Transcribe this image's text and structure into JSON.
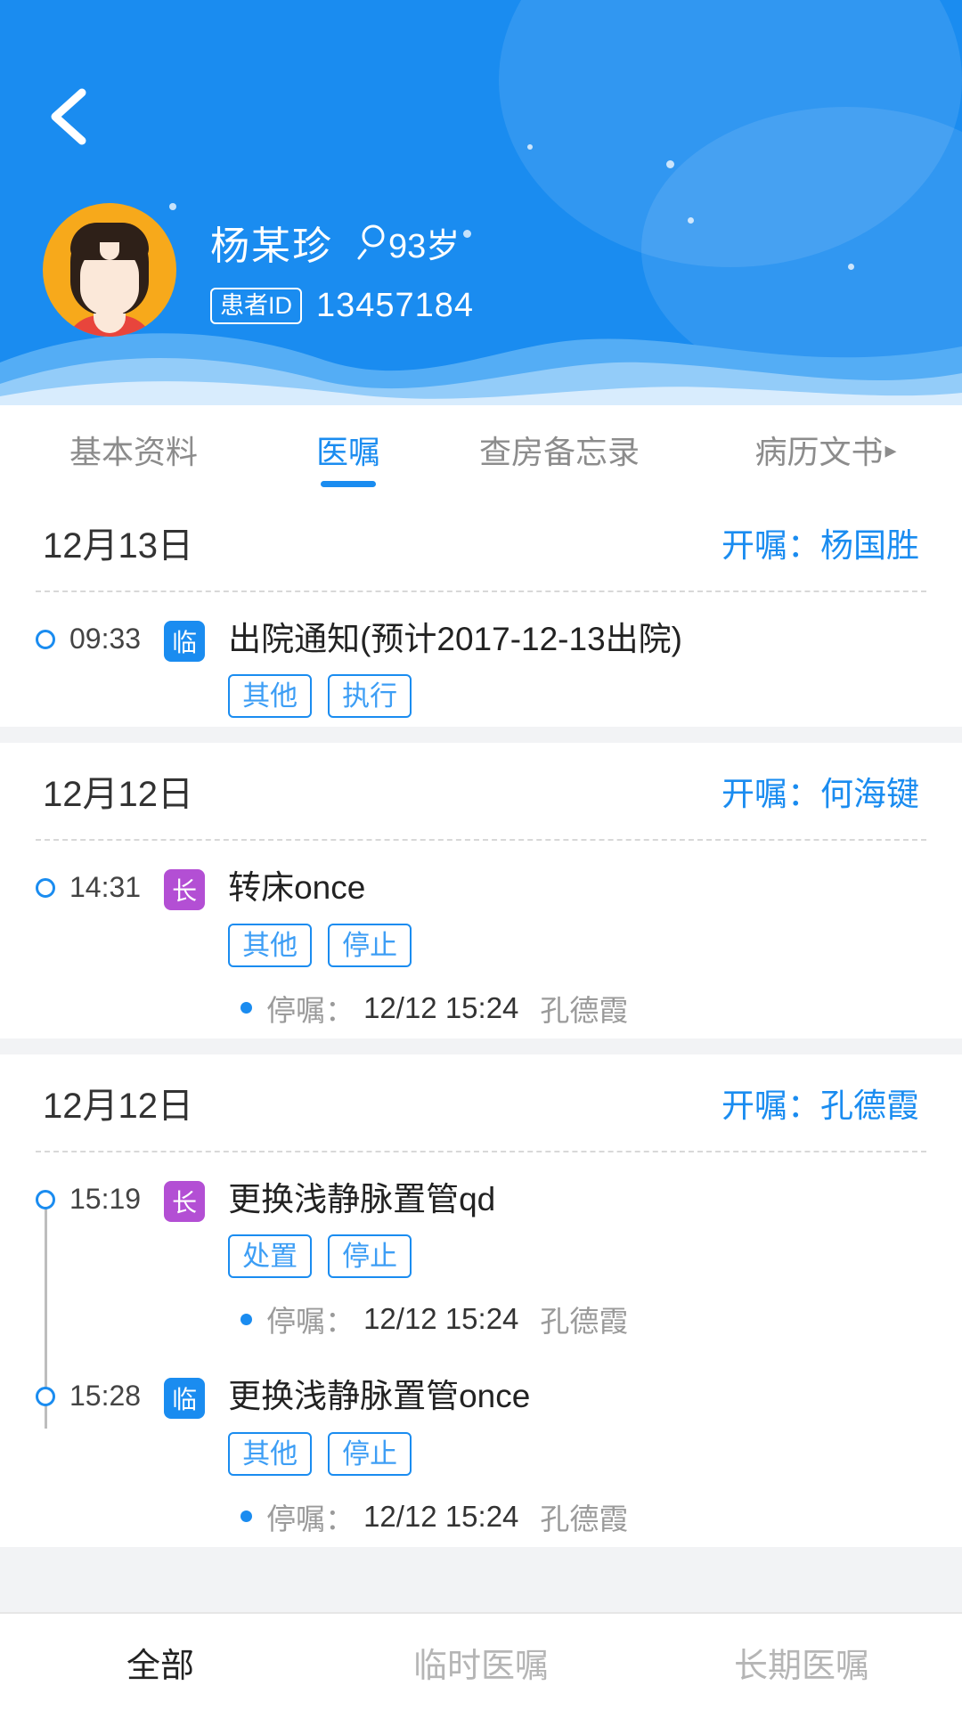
{
  "header": {
    "back_icon": "chevron-left-icon",
    "patient": {
      "name": "杨某珍",
      "gender_icon": "female-symbol-icon",
      "age": "93岁",
      "id_label": "患者ID",
      "id_value": "13457184"
    },
    "accent_color": "#1a8cf0",
    "avatar_bg": "#f7a91b"
  },
  "tabs": [
    {
      "label": "基本资料",
      "active": false
    },
    {
      "label": "医嘱",
      "active": true
    },
    {
      "label": "查房备忘录",
      "active": false
    },
    {
      "label": "病历文书",
      "active": false,
      "arrow": "▸"
    }
  ],
  "sections": [
    {
      "date": "12月13日",
      "doctor_label": "开嘱：",
      "doctor": "杨国胜",
      "orders": [
        {
          "time": "09:33",
          "type_badge": "临",
          "type_class": "lin",
          "title": "出院通知(预计2017-12-13出院)",
          "chips": [
            "其他",
            "执行"
          ],
          "note": null
        }
      ]
    },
    {
      "date": "12月12日",
      "doctor_label": "开嘱：",
      "doctor": "何海键",
      "orders": [
        {
          "time": "14:31",
          "type_badge": "长",
          "type_class": "chang",
          "title": "转床once",
          "chips": [
            "其他",
            "停止"
          ],
          "note": {
            "label": "停嘱：",
            "time": "12/12 15:24",
            "by": "孔德霞"
          }
        }
      ]
    },
    {
      "date": "12月12日",
      "doctor_label": "开嘱：",
      "doctor": "孔德霞",
      "orders": [
        {
          "time": "15:19",
          "type_badge": "长",
          "type_class": "chang",
          "title": "更换浅静脉置管qd",
          "chips": [
            "处置",
            "停止"
          ],
          "note": {
            "label": "停嘱：",
            "time": "12/12 15:24",
            "by": "孔德霞"
          }
        },
        {
          "time": "15:28",
          "type_badge": "临",
          "type_class": "lin",
          "title": "更换浅静脉置管once",
          "chips": [
            "其他",
            "停止"
          ],
          "note": {
            "label": "停嘱：",
            "time": "12/12 15:24",
            "by": "孔德霞"
          }
        }
      ]
    }
  ],
  "bottom_nav": [
    {
      "label": "全部",
      "active": true
    },
    {
      "label": "临时医嘱",
      "active": false
    },
    {
      "label": "长期医嘱",
      "active": false
    }
  ]
}
